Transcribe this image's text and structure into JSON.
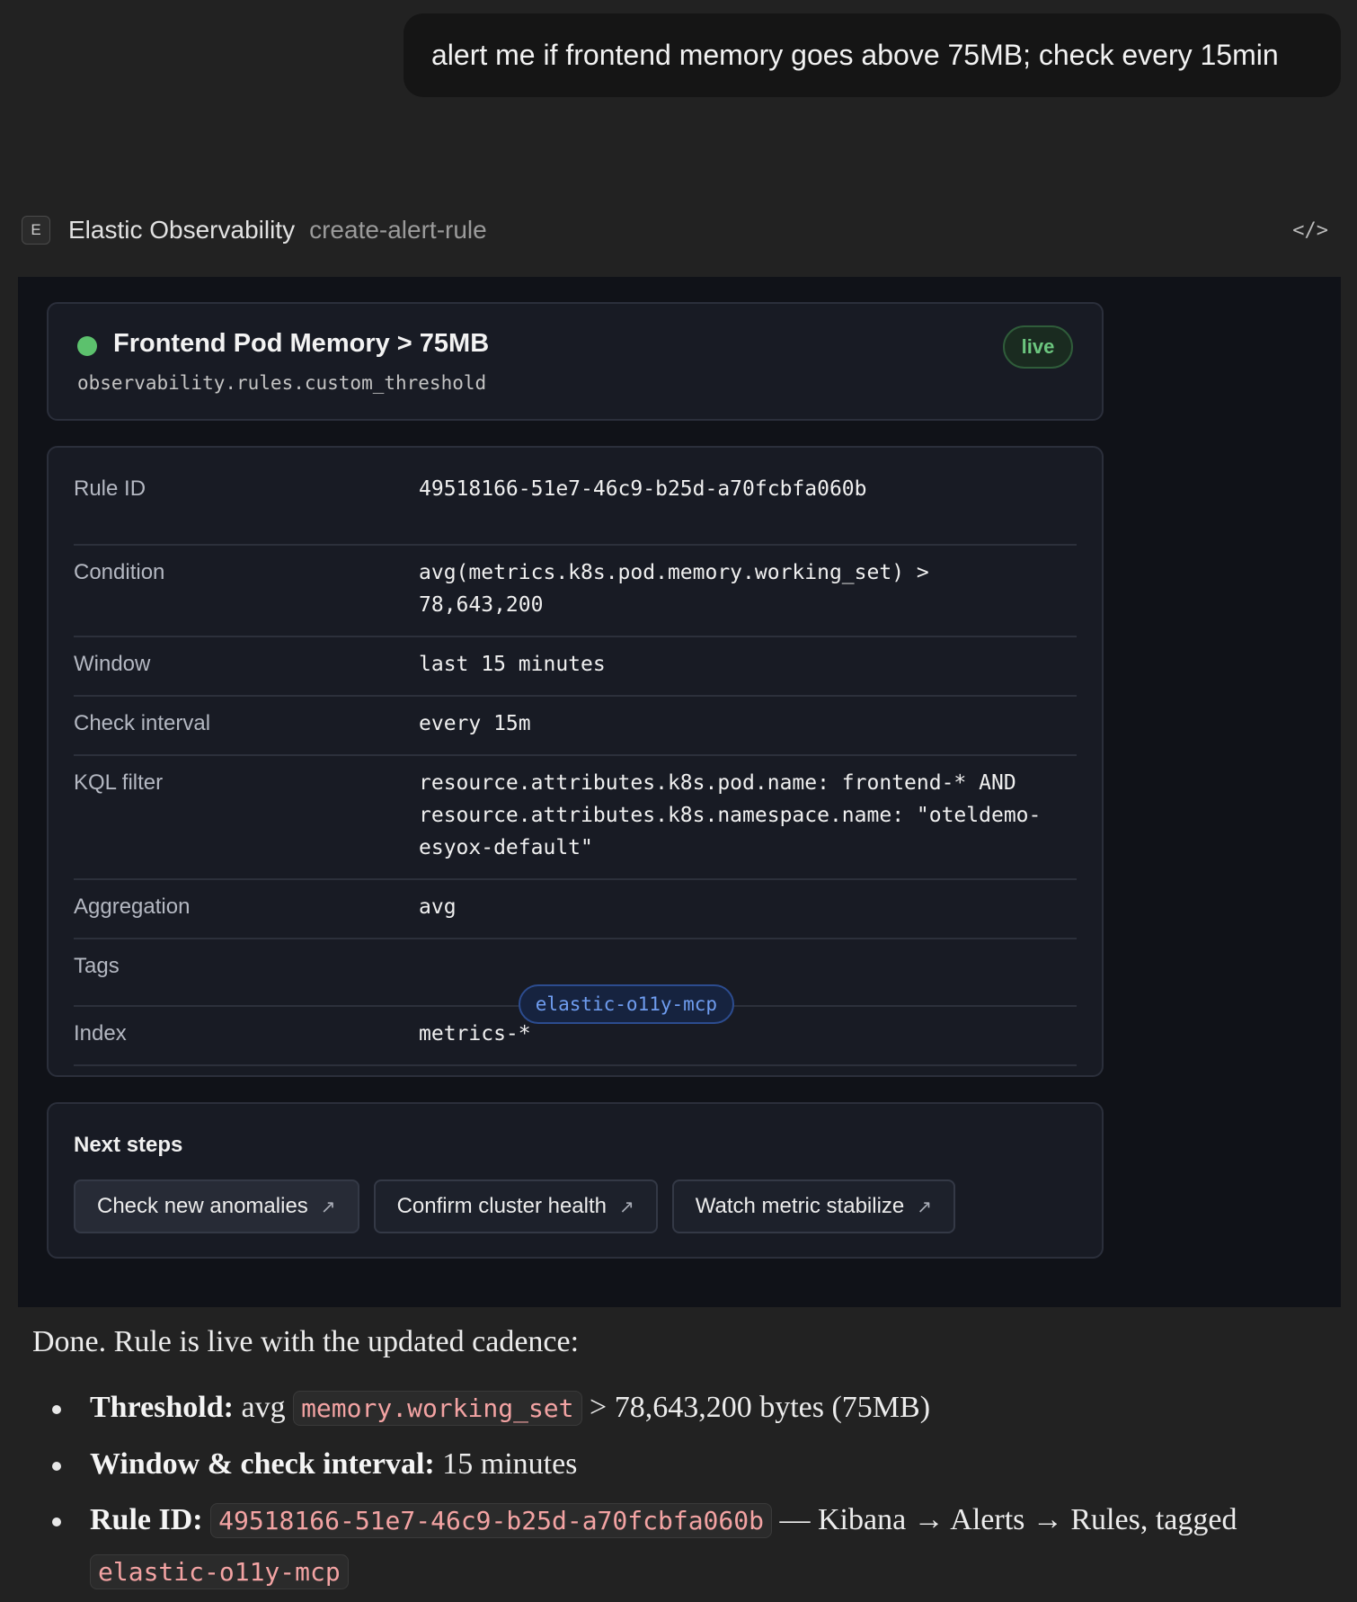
{
  "user_message": "alert me if frontend memory goes above 75MB; check every 15min",
  "tool_call": {
    "badge": "E",
    "app_name": "Elastic Observability",
    "tool_name": "create-alert-rule",
    "code_toggle": "</>"
  },
  "rule": {
    "title": "Frontend Pod Memory > 75MB",
    "type": "observability.rules.custom_threshold",
    "status": "live",
    "status_color": "#5cc16d"
  },
  "details": [
    {
      "label": "Rule ID",
      "value": "49518166-51e7-46c9-b25d-a70fcbfa060b"
    },
    {
      "label": "Condition",
      "value": "avg(metrics.k8s.pod.memory.working_set) >\n78,643,200"
    },
    {
      "label": "Window",
      "value": "last 15 minutes"
    },
    {
      "label": "Check interval",
      "value": "every 15m"
    },
    {
      "label": "KQL filter",
      "value": "resource.attributes.k8s.pod.name: frontend-* AND\nresource.attributes.k8s.namespace.name: \"oteldemo-\nesyox-default\""
    },
    {
      "label": "Aggregation",
      "value": "avg"
    },
    {
      "label": "Tags",
      "value": "elastic-o11y-mcp"
    },
    {
      "label": "Index",
      "value": "metrics-*"
    }
  ],
  "next_steps": {
    "title": "Next steps",
    "buttons": [
      "Check new anomalies",
      "Confirm cluster health",
      "Watch metric stabilize"
    ],
    "arrow": "↗"
  },
  "reply": {
    "intro": "Done. Rule is live with the updated cadence:",
    "bullets": [
      {
        "label": "Threshold:",
        "pre": " avg ",
        "code": "memory.working_set",
        "post": " > 78,643,200 bytes (75MB)"
      },
      {
        "label": "Window & check interval:",
        "post": " 15 minutes"
      },
      {
        "label": "Rule ID:",
        "pre": " ",
        "code": "49518166-51e7-46c9-b25d-a70fcbfa060b",
        "post": " — Kibana → Alerts → Rules, tagged ",
        "code2": "elastic-o11y-mcp"
      }
    ]
  }
}
